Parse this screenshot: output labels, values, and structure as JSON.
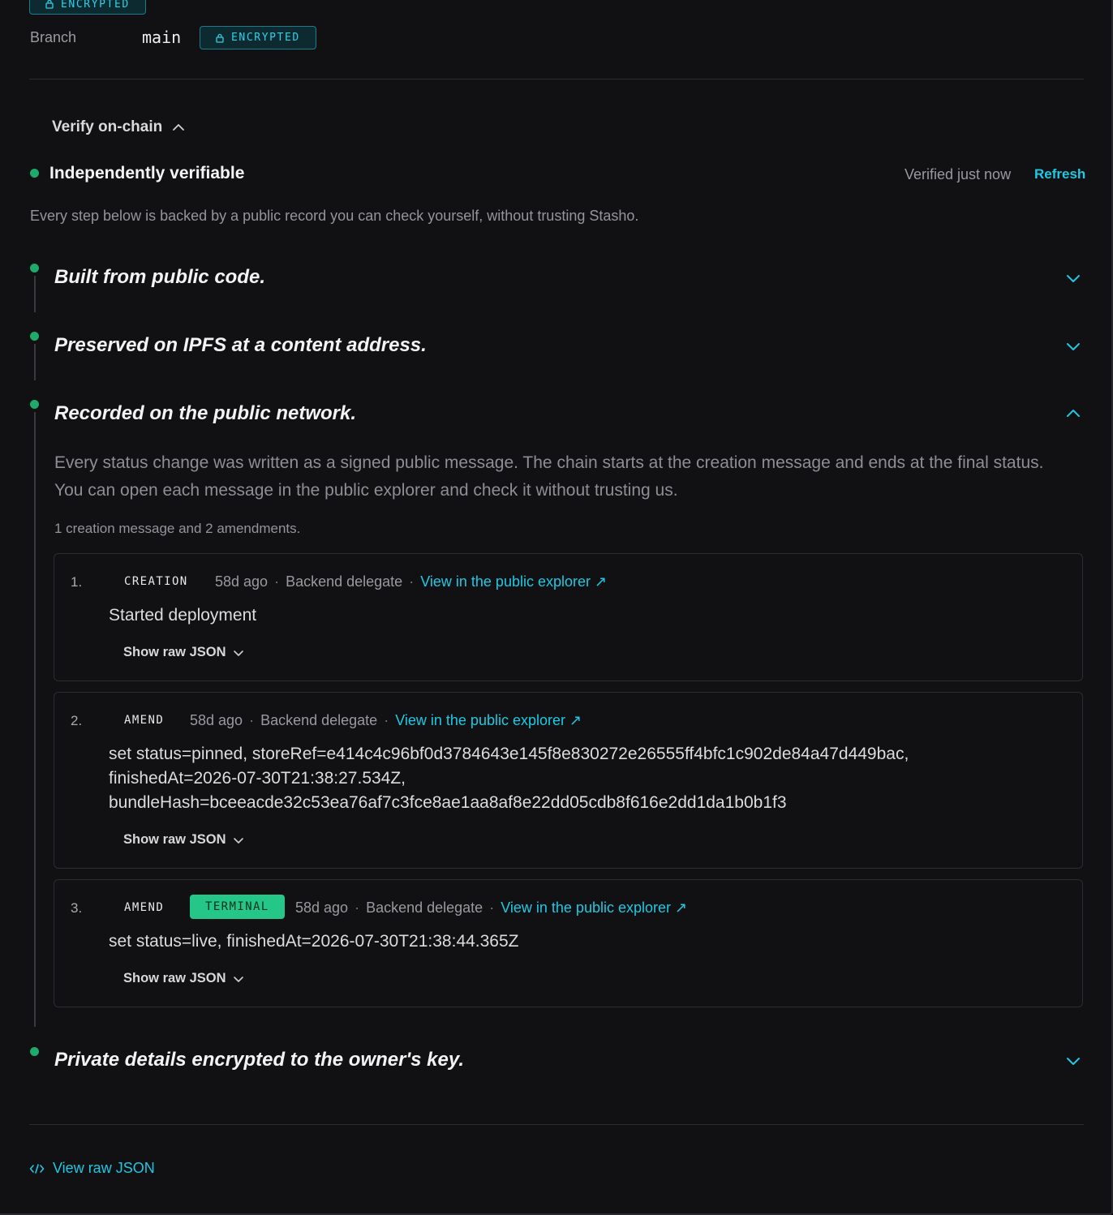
{
  "top_badge": "ENCRYPTED",
  "branch": {
    "label": "Branch",
    "value": "main",
    "badge": "ENCRYPTED"
  },
  "verify": {
    "toggle_label": "Verify on-chain",
    "status_title": "Independently verifiable",
    "verified_text": "Verified just now",
    "refresh_label": "Refresh",
    "description": "Every step below is backed by a public record you can check yourself, without trusting Stasho."
  },
  "steps": [
    {
      "title": "Built from public code."
    },
    {
      "title": "Preserved on IPFS at a content address."
    },
    {
      "title": "Recorded on the public network."
    },
    {
      "title": "Private details encrypted to the owner's key."
    }
  ],
  "recorded": {
    "description": "Every status change was written as a signed public message. The chain starts at the creation message and ends at the final status. You can open each message in the public explorer and check it without trusting us.",
    "summary": "1 creation message and 2 amendments.",
    "messages": [
      {
        "index": "1.",
        "kind": "CREATION",
        "age": "58d ago",
        "actor": "Backend delegate",
        "link": "View in the public explorer ↗",
        "body_lines": [
          "Started deployment"
        ],
        "raw_label": "Show raw JSON"
      },
      {
        "index": "2.",
        "kind": "AMEND",
        "age": "58d ago",
        "actor": "Backend delegate",
        "link": "View in the public explorer ↗",
        "body_lines": [
          "set status=pinned, storeRef=e414c4c96bf0d3784643e145f8e830272e26555ff4bfc1c902de84a47d449bac,",
          "finishedAt=2026-07-30T21:38:27.534Z,",
          "bundleHash=bceeacde32c53ea76af7c3fce8ae1aa8af8e22dd05cdb8f616e2dd1da1b0b1f3"
        ],
        "raw_label": "Show raw JSON"
      },
      {
        "index": "3.",
        "kind": "AMEND",
        "badge": "TERMINAL",
        "age": "58d ago",
        "actor": "Backend delegate",
        "link": "View in the public explorer ↗",
        "body_lines": [
          "set status=live, finishedAt=2026-07-30T21:38:44.365Z"
        ],
        "raw_label": "Show raw JSON"
      }
    ]
  },
  "footer": {
    "view_raw_label": "View raw JSON"
  },
  "colors": {
    "accent": "#1fc8e3",
    "success": "#1faa6c",
    "terminal": "#24c787",
    "background": "#111114"
  }
}
